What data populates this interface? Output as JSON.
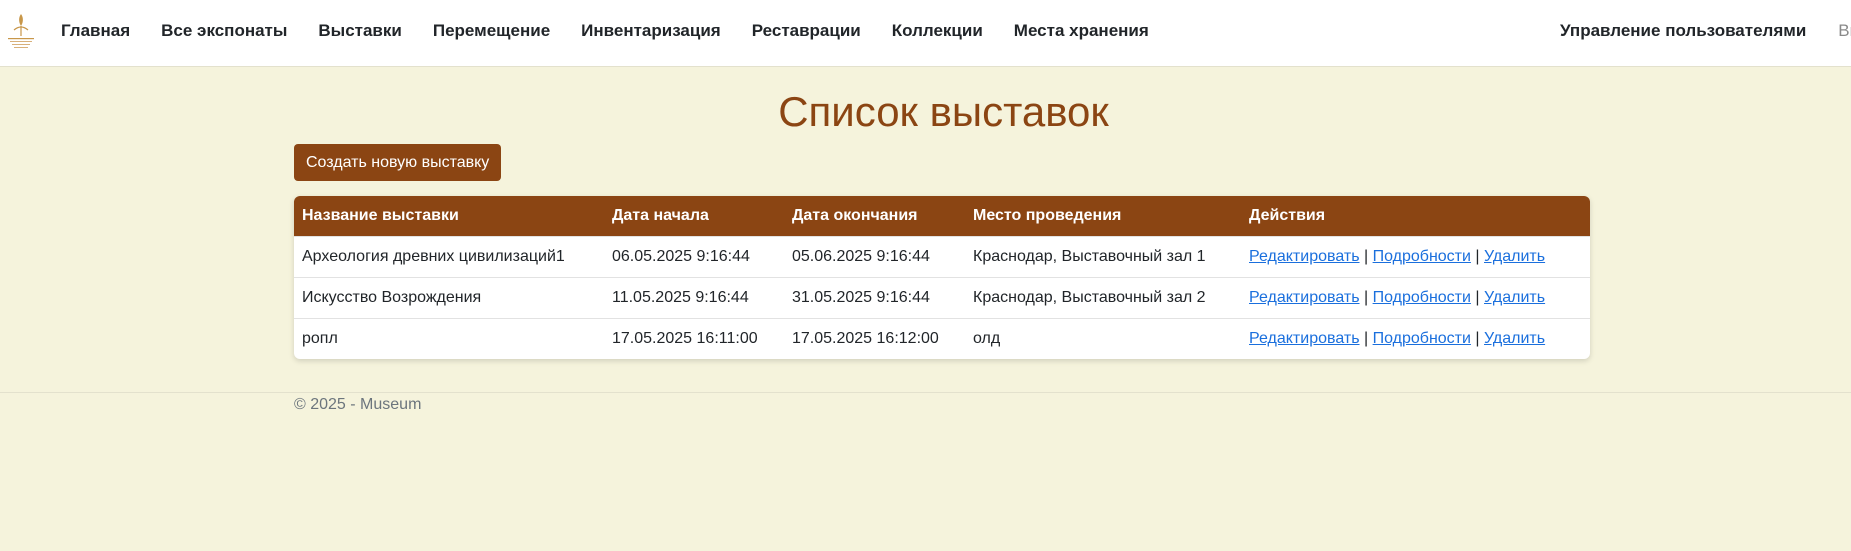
{
  "nav": {
    "links": [
      "Главная",
      "Все экспонаты",
      "Выставки",
      "Перемещение",
      "Инвентаризация",
      "Реставрации",
      "Коллекции",
      "Места хранения"
    ],
    "user_management": "Управление пользователями",
    "logout_partial": "Вый"
  },
  "page": {
    "title": "Список выставок",
    "create_button": "Создать новую выставку"
  },
  "table": {
    "headers": [
      "Название выставки",
      "Дата начала",
      "Дата окончания",
      "Место проведения",
      "Действия"
    ],
    "rows": [
      {
        "name": "Археология древних цивилизаций1",
        "start": "06.05.2025 9:16:44",
        "end": "05.06.2025 9:16:44",
        "place": "Краснодар, Выставочный зал 1"
      },
      {
        "name": "Искусство Возрождения",
        "start": "11.05.2025 9:16:44",
        "end": "31.05.2025 9:16:44",
        "place": "Краснодар, Выставочный зал 2"
      },
      {
        "name": "ропл",
        "start": "17.05.2025 16:11:00",
        "end": "17.05.2025 16:12:00",
        "place": "олд"
      }
    ],
    "actions": {
      "edit": "Редактировать",
      "details": "Подробности",
      "delete": "Удалить",
      "separator": "|"
    }
  },
  "footer": {
    "text": "© 2025 - Museum"
  },
  "colors": {
    "brand": "#8b4513",
    "background": "#f5f3dc",
    "link": "#1a6fdd"
  }
}
